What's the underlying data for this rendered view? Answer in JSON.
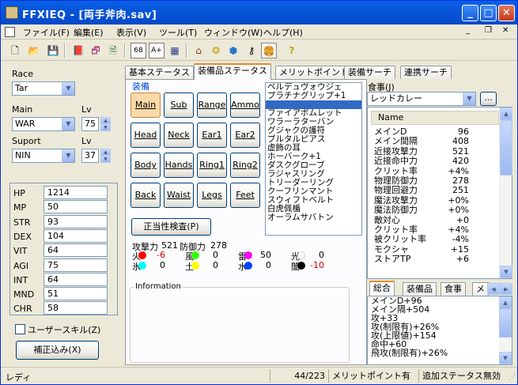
{
  "window": {
    "title": "FFXIEQ - [両手斧肉.sav]"
  },
  "menu": [
    "ファイル(F)",
    "編集(E)",
    "表示(V)",
    "ツール(T)",
    "ウィンドウ(W)",
    "ヘルプ(H)"
  ],
  "toolbar": {
    "btn68": "68",
    "btnAB": "A+"
  },
  "left": {
    "race_label": "Race",
    "race": "Tar",
    "main_label": "Main",
    "main": "WAR",
    "lv_label": "Lv",
    "main_lv": "75",
    "sub_label": "Suport",
    "sub": "NIN",
    "sub_lv_label": "Lv",
    "sub_lv": "37",
    "stats": [
      {
        "k": "HP",
        "v": "1214"
      },
      {
        "k": "MP",
        "v": "50"
      },
      {
        "k": "STR",
        "v": "93"
      },
      {
        "k": "DEX",
        "v": "104"
      },
      {
        "k": "VIT",
        "v": "64"
      },
      {
        "k": "AGI",
        "v": "75"
      },
      {
        "k": "INT",
        "v": "64"
      },
      {
        "k": "MND",
        "v": "51"
      },
      {
        "k": "CHR",
        "v": "58"
      }
    ],
    "user_skill": "ユーザースキル(Z)",
    "correction_btn": "補正込み(X)"
  },
  "tabs": [
    "基本ステータス",
    "装備品ステータス",
    "メリットポイント",
    "装備サーチ",
    "連携サーチ"
  ],
  "equip": {
    "group_label": "装備",
    "slots": [
      "Main",
      "Sub",
      "Range",
      "Ammo",
      "Head",
      "Neck",
      "Ear1",
      "Ear2",
      "Body",
      "Hands",
      "Ring1",
      "Ring2",
      "Back",
      "Waist",
      "Legs",
      "Feet"
    ],
    "validate_btn": "正当性検査(P)",
    "atk_label": "攻撃力",
    "atk": "521",
    "def_label": "防御力",
    "def": "278",
    "elements": [
      {
        "k": "火",
        "v": "-6",
        "color": "#ff0000",
        "vcolor": "#cc0000"
      },
      {
        "k": "風",
        "v": "0",
        "color": "#33ff00",
        "vcolor": "#000000"
      },
      {
        "k": "雷",
        "v": "50",
        "color": "#ff00ff",
        "vcolor": "#000000"
      },
      {
        "k": "光",
        "v": "0",
        "color": "#ffffff",
        "vcolor": "#000000"
      },
      {
        "k": "氷",
        "v": "0",
        "color": "#00ffff",
        "vcolor": "#000000"
      },
      {
        "k": "土",
        "v": "0",
        "color": "#ffff00",
        "vcolor": "#000000"
      },
      {
        "k": "水",
        "v": "0",
        "color": "#0044ff",
        "vcolor": "#000000"
      },
      {
        "k": "闇",
        "v": "-10",
        "color": "#000000",
        "vcolor": "#cc0000"
      }
    ],
    "info_label": "Information",
    "items": [
      "ペルデュヴォウジェ",
      "プラチナグリップ+1",
      "",
      "ファイアボムレット",
      "ワラーラターバン",
      "グジャクの護符",
      "ブルタルピアス",
      "虚飾の耳",
      "ホーバーク+1",
      "ダスクグローブ",
      "ラジャスリング",
      "トリーダーリング",
      "クーフリンマント",
      "スウィフトベルト",
      "白虎佩楯",
      "オーラムサバトン"
    ],
    "items_selected": 2
  },
  "food": {
    "label": "食事(J)",
    "value": "レッドカレー",
    "more_btn": "...",
    "col_header": "Name",
    "rows": [
      {
        "k": "メインD",
        "v": "96"
      },
      {
        "k": "メイン間隔",
        "v": "408"
      },
      {
        "k": "近接攻撃力",
        "v": "521"
      },
      {
        "k": "近接命中力",
        "v": "420"
      },
      {
        "k": "クリット率",
        "v": "+4%"
      },
      {
        "k": "物理防御力",
        "v": "278"
      },
      {
        "k": "物理回避力",
        "v": "251"
      },
      {
        "k": "魔法攻撃力",
        "v": "+0%"
      },
      {
        "k": "魔法防御力",
        "v": "+0%"
      },
      {
        "k": "敵対心",
        "v": "+0"
      },
      {
        "k": "クリット率",
        "v": "+4%"
      },
      {
        "k": "被クリット率",
        "v": "-4%"
      },
      {
        "k": "モクシャ",
        "v": "+15"
      },
      {
        "k": "ストアTP",
        "v": "+6"
      }
    ],
    "subtabs": [
      "総合",
      "装備品",
      "食事",
      "メ"
    ],
    "summary": [
      "メインD+96",
      "メイン隔+504",
      "攻+33",
      "攻(制限有)+26%",
      "攻(上限値)+154",
      "命中+60",
      "飛攻(制限有)+26%"
    ]
  },
  "status": {
    "left": "レディ",
    "count": "44/223",
    "merit": "メリットポイント有効",
    "extra": "追加ステータス無効"
  }
}
